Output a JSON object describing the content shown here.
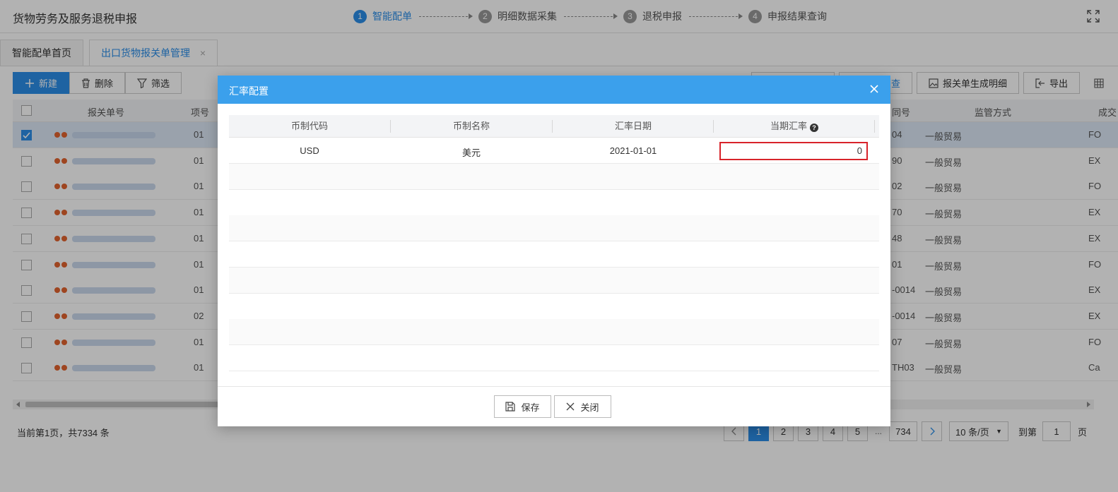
{
  "app": {
    "title": "货物劳务及服务退税申报",
    "steps": [
      {
        "num": "1",
        "label": "智能配单"
      },
      {
        "num": "2",
        "label": "明细数据采集"
      },
      {
        "num": "3",
        "label": "退税申报"
      },
      {
        "num": "4",
        "label": "申报结果查询"
      }
    ],
    "active_step": 1
  },
  "tabs": [
    {
      "label": "智能配单首页"
    },
    {
      "label": "出口货物报关单管理",
      "close": "×"
    }
  ],
  "toolbar": {
    "new_label": "新建",
    "delete_label": "删除",
    "filter_label": "筛选",
    "query_label": "查",
    "generate_detail_label": "报关单生成明细",
    "export_label": "导出"
  },
  "grid": {
    "headers": [
      "报关单号",
      "项号",
      "同号",
      "监管方式",
      "成交"
    ],
    "rows": [
      {
        "item": "01",
        "contract": "04",
        "mode": "一般贸易",
        "deal": "FO",
        "selected": true
      },
      {
        "item": "01",
        "contract": "90",
        "mode": "一般贸易",
        "deal": "EX"
      },
      {
        "item": "01",
        "contract": "02",
        "mode": "一般贸易",
        "deal": "FO"
      },
      {
        "item": "01",
        "contract": "70",
        "mode": "一般贸易",
        "deal": "EX"
      },
      {
        "item": "01",
        "contract": "48",
        "mode": "一般贸易",
        "deal": "EX"
      },
      {
        "item": "01",
        "contract": "01",
        "mode": "一般贸易",
        "deal": "FO"
      },
      {
        "item": "01",
        "contract": "-0014",
        "mode": "一般贸易",
        "deal": "EX"
      },
      {
        "item": "02",
        "contract": "-0014",
        "mode": "一般贸易",
        "deal": "EX"
      },
      {
        "item": "01",
        "contract": "07",
        "mode": "一般贸易",
        "deal": "FO"
      },
      {
        "item": "01",
        "contract": "TH03",
        "mode": "一般贸易",
        "deal": "Ca"
      }
    ]
  },
  "pagination": {
    "info": "当前第1页，共7334 条",
    "pages": [
      "1",
      "2",
      "3",
      "4",
      "5"
    ],
    "ellipsis": "...",
    "last_page": "734",
    "current_page": "1",
    "page_size": "10 条/页",
    "goto_label": "到第",
    "goto_value": "1",
    "goto_suffix": "页"
  },
  "dialog": {
    "title": "汇率配置",
    "columns": [
      "币制代码",
      "币制名称",
      "汇率日期",
      "当期汇率"
    ],
    "row": {
      "code": "USD",
      "name": "美元",
      "date": "2021-01-01",
      "rate": "0"
    },
    "save_label": "保存",
    "close_label": "关闭"
  },
  "colors": {
    "accent": "#2b8ee8",
    "dialog_header": "#3ba0ec",
    "highlight_border": "#d8232a",
    "status_dot": "#e2632e"
  }
}
